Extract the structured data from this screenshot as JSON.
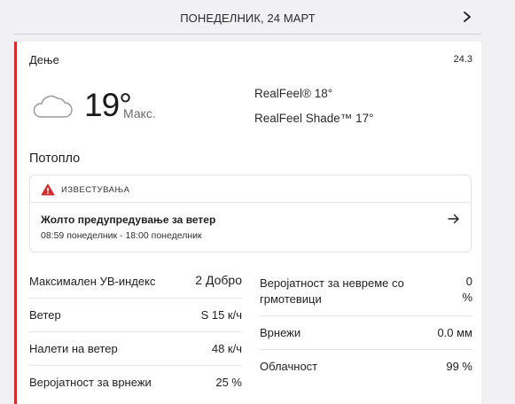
{
  "day_nav": {
    "title": "ПОНЕДЕЛНИК, 24 МАРТ",
    "next_icon": "chevron-right-icon"
  },
  "card": {
    "label": "Дење",
    "date": "24.3",
    "accent_color": "#d32f2f",
    "weather_icon": "cloud-icon",
    "temperature": "19°",
    "temp_label": "Макс.",
    "realfeel": "RealFeel® 18°",
    "realfeel_shade": "RealFeel Shade™ 17°",
    "phrase": "Потопло"
  },
  "alert": {
    "icon": "warning-icon",
    "icon_color": "#d32f2f",
    "title": "ИЗВЕСТУВАЊА",
    "name": "Жолто предупредување за ветер",
    "time": "08:59 понеделник - 18:00 понеделник",
    "arrow_icon": "arrow-right-icon"
  },
  "details_left": [
    {
      "label": "Максимален УВ-индекс",
      "value": "2 Добро"
    },
    {
      "label": "Ветер",
      "value": "S 15 к/ч"
    },
    {
      "label": "Налети на ветер",
      "value": "48 к/ч"
    },
    {
      "label": "Веројатност за врнежи",
      "value": "25 %"
    }
  ],
  "details_right": [
    {
      "label": "Веројатност за невреме со грмотевици",
      "value": "0 %"
    },
    {
      "label": "Врнежи",
      "value": "0.0 мм"
    },
    {
      "label": "Облачност",
      "value": "99 %"
    }
  ]
}
